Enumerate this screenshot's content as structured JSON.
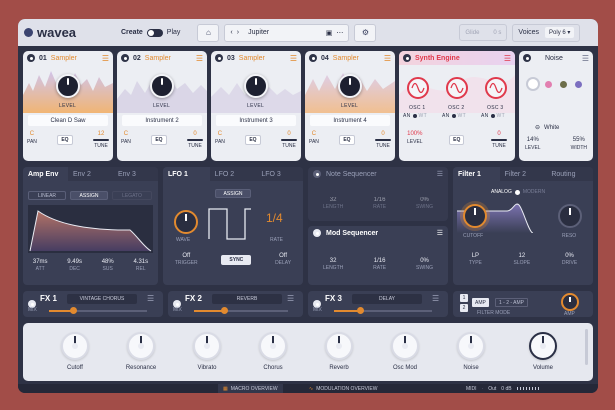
{
  "app": {
    "name": "wavea"
  },
  "topbar": {
    "create": "Create",
    "play": "Play",
    "preset": "Jupiter",
    "glide": "Glide",
    "glide_val": "0 s",
    "voices_label": "Voices",
    "voices_value": "Poly 6"
  },
  "samplers": [
    {
      "num": "01",
      "title": "Sampler",
      "level": "LEVEL",
      "sample": "Clean D Saw",
      "pan": "C",
      "pan_l": "PAN",
      "eq": "EQ",
      "tune": "12",
      "tune_l": "TUNE"
    },
    {
      "num": "02",
      "title": "Sampler",
      "level": "LEVEL",
      "sample": "Instrument 2",
      "pan": "C",
      "pan_l": "PAN",
      "eq": "EQ",
      "tune": "0",
      "tune_l": "TUNE"
    },
    {
      "num": "03",
      "title": "Sampler",
      "level": "LEVEL",
      "sample": "Instrument 3",
      "pan": "C",
      "pan_l": "PAN",
      "eq": "EQ",
      "tune": "0",
      "tune_l": "TUNE"
    },
    {
      "num": "04",
      "title": "Sampler",
      "level": "LEVEL",
      "sample": "Instrument 4",
      "pan": "C",
      "pan_l": "PAN",
      "eq": "EQ",
      "tune": "0",
      "tune_l": "TUNE"
    }
  ],
  "synth": {
    "title": "Synth Engine",
    "osc": [
      "OSC 1",
      "OSC 2",
      "OSC 3"
    ],
    "an": "AN",
    "wt": "WT",
    "level": "100%",
    "level_l": "LEVEL",
    "eq": "EQ",
    "tune": "0",
    "tune_l": "TUNE"
  },
  "noise": {
    "title": "Noise",
    "type": "White",
    "level": "14%",
    "level_l": "LEVEL",
    "width": "55%",
    "width_l": "WIDTH"
  },
  "env": {
    "tabs": [
      "Amp Env",
      "Env 2",
      "Env 3"
    ],
    "modes": [
      "LINEAR",
      "ASSIGN",
      "LEGATO"
    ],
    "params": [
      {
        "v": "37ms",
        "l": "ATT"
      },
      {
        "v": "9.49s",
        "l": "DEC"
      },
      {
        "v": "48%",
        "l": "SUS"
      },
      {
        "v": "4.31s",
        "l": "REL"
      }
    ]
  },
  "lfo": {
    "tabs": [
      "LFO 1",
      "LFO 2",
      "LFO 3"
    ],
    "assign": "ASSIGN",
    "wave": "WAVE",
    "rate": "1/4",
    "rate_l": "RATE",
    "trigger": "Off",
    "trigger_l": "TRIGGER",
    "sync": "SYNC",
    "delay": "Off",
    "delay_l": "DELAY"
  },
  "note_seq": {
    "title": "Note Sequencer",
    "params": [
      {
        "v": "32",
        "l": "LENGTH"
      },
      {
        "v": "1/16",
        "l": "RATE"
      },
      {
        "v": "0%",
        "l": "SWING"
      }
    ]
  },
  "mod_seq": {
    "title": "Mod Sequencer",
    "params": [
      {
        "v": "32",
        "l": "LENGTH"
      },
      {
        "v": "1/16",
        "l": "RATE"
      },
      {
        "v": "0%",
        "l": "SWING"
      }
    ]
  },
  "filter": {
    "tabs": [
      "Filter 1",
      "Filter 2",
      "Routing"
    ],
    "analog": "ANALOG",
    "modern": "MODERN",
    "cutoff": "CUTOFF",
    "reso": "RESO",
    "params": [
      {
        "v": "LP",
        "l": "TYPE"
      },
      {
        "v": "12",
        "l": "SLOPE"
      },
      {
        "v": "0%",
        "l": "DRIVE"
      }
    ],
    "mode_amp": "AMP",
    "mode_seq": "1 - 2 - AMP",
    "mode_label": "FILTER MODE",
    "amp": "AMP"
  },
  "fx": [
    {
      "name": "FX",
      "num": "1",
      "type": "VINTAGE CHORUS",
      "mix": "MIX"
    },
    {
      "name": "FX",
      "num": "2",
      "type": "REVERB",
      "mix": "MIX"
    },
    {
      "name": "FX",
      "num": "3",
      "type": "DELAY",
      "mix": "MIX"
    }
  ],
  "macros": [
    "Cutoff",
    "Resonance",
    "Vibrato",
    "Chorus",
    "Reverb",
    "Osc Mod",
    "Noise",
    "Volume"
  ],
  "bottom": {
    "macro_overview": "MACRO OVERVIEW",
    "mod_overview": "MODULATION OVERVIEW",
    "midi": "MIDI",
    "out": "Out",
    "db": "0 dB"
  },
  "colors": {
    "accent": "#e28a2f",
    "synth": "#e0394c",
    "panel": "#3a3f55",
    "frame": "#2e3245",
    "bg": "#a24d48"
  }
}
